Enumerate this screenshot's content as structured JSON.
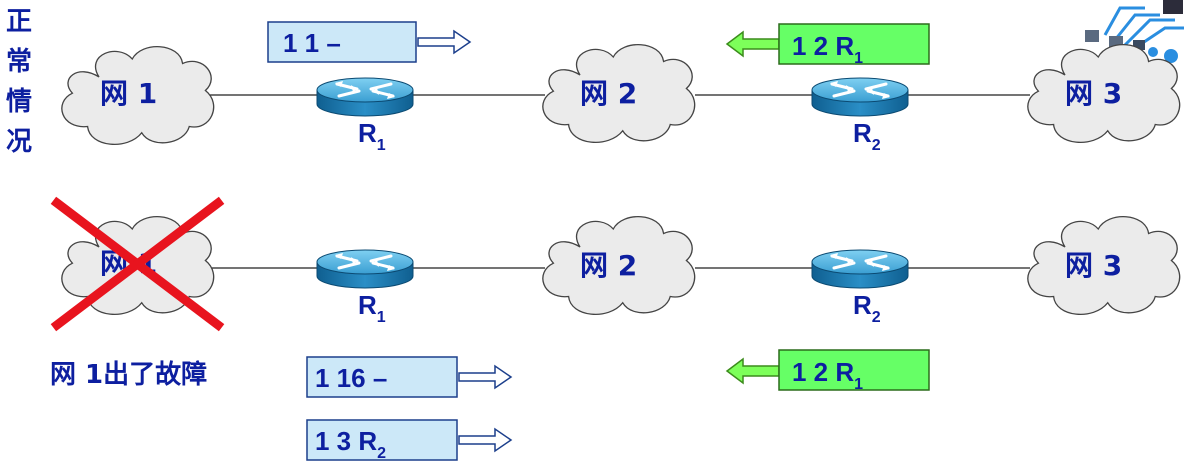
{
  "side_label": [
    "正",
    "常",
    "情",
    "况"
  ],
  "top_row": {
    "net1": "网 1",
    "net2": "网 2",
    "net3": "网 3",
    "r1": {
      "main": "R",
      "sub": "1"
    },
    "r2": {
      "main": "R",
      "sub": "2"
    },
    "msg_right": {
      "text": "1  1  –",
      "sub": ""
    },
    "msg_left": {
      "text": "1  2  R",
      "sub": "1"
    }
  },
  "bottom_row": {
    "net1": "网 1",
    "net2": "网 2",
    "net3": "网 3",
    "r1": {
      "main": "R",
      "sub": "1"
    },
    "r2": {
      "main": "R",
      "sub": "2"
    },
    "fault_note": "网 1出了故障",
    "msg_right_1": {
      "text": "1  16  –",
      "sub": ""
    },
    "msg_right_2": {
      "text": "1  3  R",
      "sub": "2"
    },
    "msg_left": {
      "text": "1  2  R",
      "sub": "1"
    }
  },
  "colors": {
    "label_blue": "#0d1fa0",
    "blue_box": "#cce8f8",
    "green_box": "#66ff66",
    "cross_red": "#e8141e",
    "router_top": "#4fb2e0",
    "router_side": "#1a7db4"
  },
  "icons": {
    "router": "router-icon",
    "cloud": "cloud-icon",
    "cross": "cross-icon",
    "arrow": "arrow-icon"
  }
}
